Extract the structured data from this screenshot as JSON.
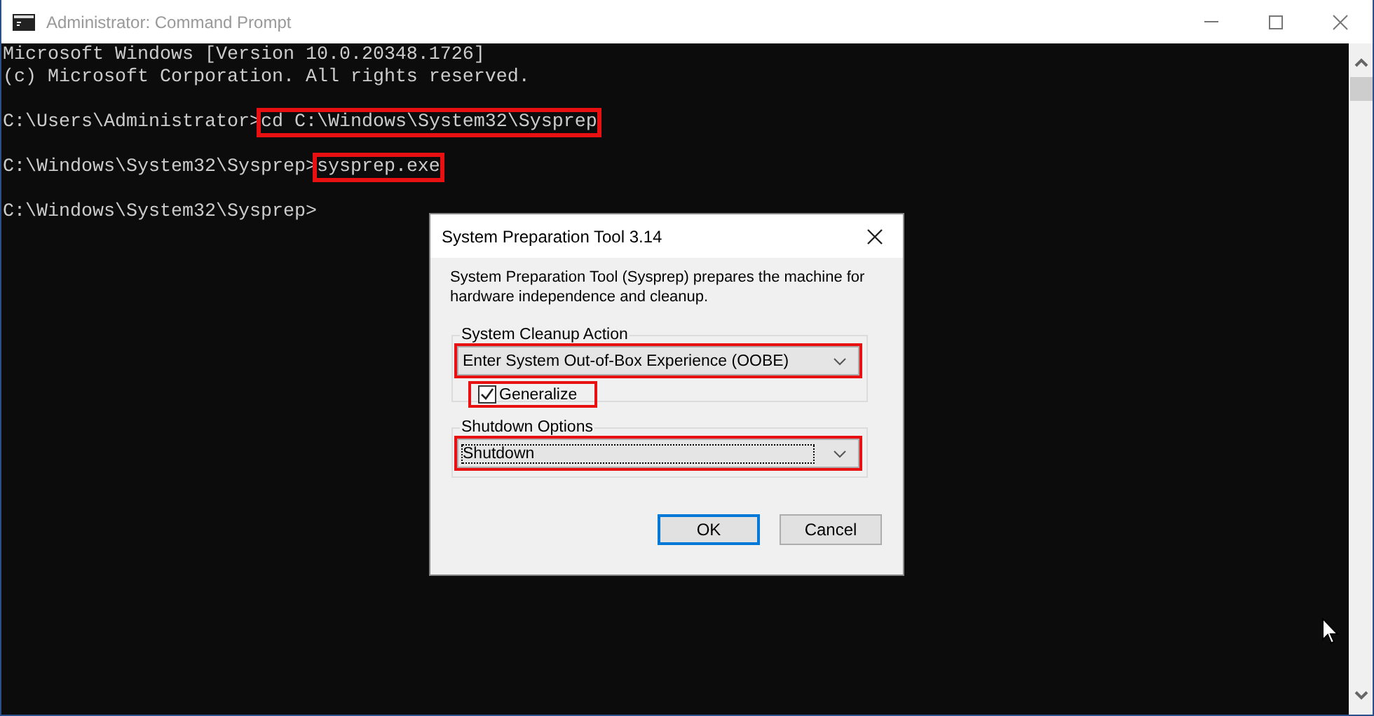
{
  "window": {
    "title": "Administrator: Command Prompt",
    "active": false
  },
  "console": {
    "lines": [
      {
        "kind": "output",
        "text": "Microsoft Windows [Version 10.0.20348.1726]"
      },
      {
        "kind": "output",
        "text": "(c) Microsoft Corporation. All rights reserved."
      },
      {
        "kind": "prompt",
        "prompt": "C:\\Users\\Administrator>",
        "command": "cd C:\\Windows\\System32\\Sysprep",
        "highlighted": true
      },
      {
        "kind": "prompt",
        "prompt": "C:\\Windows\\System32\\Sysprep>",
        "command": "sysprep.exe",
        "highlighted": true
      },
      {
        "kind": "prompt",
        "prompt": "C:\\Windows\\System32\\Sysprep>"
      }
    ]
  },
  "dialog": {
    "title": "System Preparation Tool 3.14",
    "description": "System Preparation Tool (Sysprep) prepares the machine for hardware independence and cleanup.",
    "cleanup_group": {
      "label": "System Cleanup Action",
      "dropdown": {
        "value": "Enter System Out-of-Box Experience (OOBE)",
        "highlighted": true,
        "focused": false
      },
      "checkbox": {
        "label": "Generalize",
        "checked": true,
        "highlighted": true
      }
    },
    "shutdown_group": {
      "label": "Shutdown Options",
      "dropdown": {
        "value": "Shutdown",
        "highlighted": true,
        "focused": true
      }
    },
    "buttons": [
      {
        "label": "OK",
        "default": true
      },
      {
        "label": "Cancel",
        "default": false
      }
    ]
  }
}
